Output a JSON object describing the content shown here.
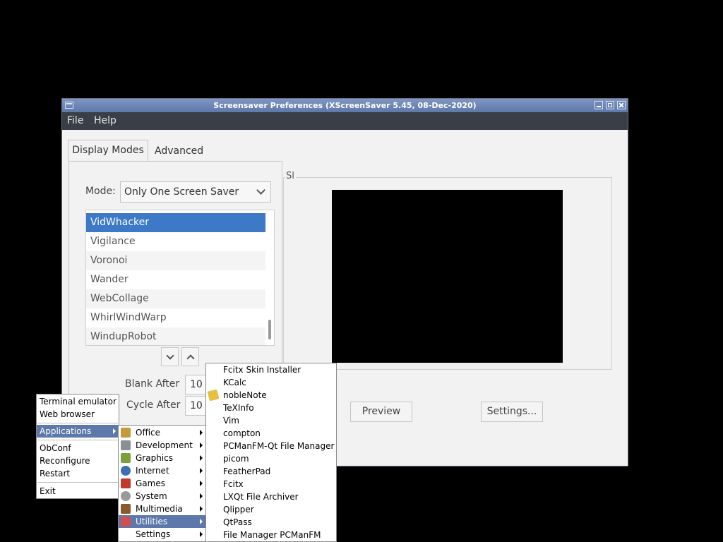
{
  "window": {
    "title": "Screensaver Preferences  (XScreenSaver 5.45, 08-Dec-2020)",
    "menu": [
      "File",
      "Help"
    ],
    "tabs": [
      "Display Modes",
      "Advanced"
    ],
    "mode_label": "Mode:",
    "mode_value": "Only One Screen Saver",
    "savers": [
      {
        "name": "VidWhacker",
        "selected": true
      },
      {
        "name": "Vigilance"
      },
      {
        "name": "Voronoi"
      },
      {
        "name": "Wander"
      },
      {
        "name": "WebCollage"
      },
      {
        "name": "WhirlWindWarp"
      },
      {
        "name": "WindupRobot"
      }
    ],
    "frame_label": "Sl",
    "blank_after_label": "Blank After",
    "blank_after_value": "10",
    "cycle_after_label": "Cycle After",
    "cycle_after_value": "10",
    "preview_button": "Preview",
    "settings_button": "Settings..."
  },
  "root_menu": {
    "items": [
      "Terminal emulator",
      "Web browser",
      "Applications",
      "ObConf",
      "Reconfigure",
      "Restart",
      "Exit"
    ]
  },
  "apps_menu": {
    "items": [
      {
        "label": "Office",
        "icon": "office-icon",
        "color": "#c49a3a"
      },
      {
        "label": "Development",
        "icon": "development-icon",
        "color": "#8a8f96"
      },
      {
        "label": "Graphics",
        "icon": "graphics-icon",
        "color": "#7aa03a"
      },
      {
        "label": "Internet",
        "icon": "internet-icon",
        "color": "#3b6fb6"
      },
      {
        "label": "Games",
        "icon": "games-icon",
        "color": "#c0392b"
      },
      {
        "label": "System",
        "icon": "system-icon",
        "color": "#9a9a9a"
      },
      {
        "label": "Multimedia",
        "icon": "multimedia-icon",
        "color": "#8b5a2b"
      },
      {
        "label": "Utilities",
        "icon": "utilities-icon",
        "color": "#d05050"
      },
      {
        "label": "Settings",
        "icon": "",
        "color": ""
      }
    ]
  },
  "utilities_menu": {
    "items": [
      "Fcitx Skin Installer",
      "KCalc",
      "nobleNote",
      "TeXInfo",
      "Vim",
      "compton",
      "PCManFM-Qt File Manager",
      "picom",
      "FeatherPad",
      "Fcitx",
      "LXQt File Archiver",
      "Qlipper",
      "QtPass",
      "File Manager PCManFM"
    ],
    "note_icon_color": "#e8c040"
  }
}
